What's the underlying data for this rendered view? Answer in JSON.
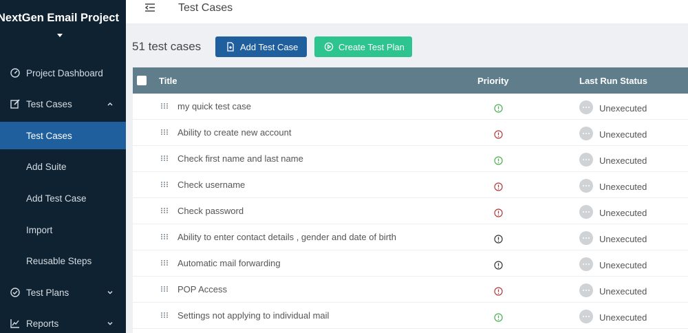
{
  "sidebar": {
    "project_title": "NextGen Email Project",
    "items": [
      {
        "label": "Project Dashboard",
        "icon": "dashboard-icon"
      },
      {
        "label": "Test Cases",
        "icon": "edit-icon",
        "expanded": true
      },
      {
        "label": "Test Cases",
        "active": true
      },
      {
        "label": "Add Suite"
      },
      {
        "label": "Add Test Case"
      },
      {
        "label": "Import"
      },
      {
        "label": "Reusable Steps"
      },
      {
        "label": "Test Plans",
        "icon": "check-circle-icon"
      },
      {
        "label": "Reports",
        "icon": "chart-icon"
      }
    ]
  },
  "header": {
    "title": "Test Cases"
  },
  "toolbar": {
    "count_label": "51 test cases",
    "add_label": "Add Test Case",
    "plan_label": "Create Test Plan"
  },
  "table": {
    "columns": [
      "Title",
      "Priority",
      "Last Run Status"
    ],
    "rows": [
      {
        "title": "my quick test case",
        "priority": "low",
        "status": "Unexecuted"
      },
      {
        "title": "Ability to create new account",
        "priority": "high",
        "status": "Unexecuted"
      },
      {
        "title": "Check first name and last name",
        "priority": "low",
        "status": "Unexecuted"
      },
      {
        "title": "Check username",
        "priority": "high",
        "status": "Unexecuted"
      },
      {
        "title": "Check password",
        "priority": "high",
        "status": "Unexecuted"
      },
      {
        "title": "Ability to enter contact details , gender and date of birth",
        "priority": "medium",
        "status": "Unexecuted"
      },
      {
        "title": "Automatic mail forwarding",
        "priority": "medium",
        "status": "Unexecuted"
      },
      {
        "title": "POP Access",
        "priority": "high",
        "status": "Unexecuted"
      },
      {
        "title": "Settings not applying to individual mail",
        "priority": "low",
        "status": "Unexecuted"
      }
    ]
  },
  "colors": {
    "sidebar_bg": "#0f2231",
    "active_bg": "#1f5f9e",
    "add_button": "#1f5f9e",
    "plan_button": "#2ec48f",
    "table_header": "#607d8b",
    "priority_low": "#4caf50",
    "priority_high": "#b03a3a",
    "priority_medium": "#333333"
  }
}
